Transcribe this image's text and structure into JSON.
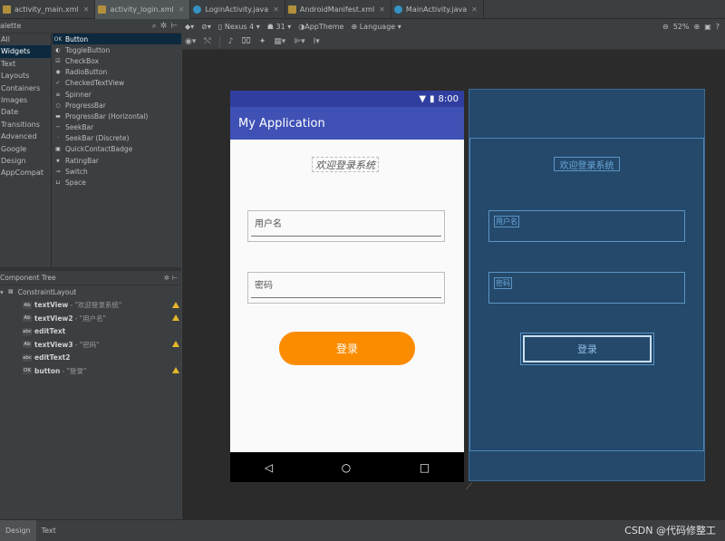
{
  "tabs": [
    {
      "label": "activity_main.xml",
      "icon": "xml"
    },
    {
      "label": "activity_login.xml",
      "icon": "xml",
      "active": true
    },
    {
      "label": "LoginActivity.java",
      "icon": "java"
    },
    {
      "label": "AndroidManifest.xml",
      "icon": "xml"
    },
    {
      "label": "MainActivity.java",
      "icon": "java"
    }
  ],
  "palette": {
    "title": "alette",
    "categories": [
      "All",
      "Widgets",
      "Text",
      "Layouts",
      "Containers",
      "Images",
      "Date",
      "Transitions",
      "Advanced",
      "Google",
      "Design",
      "AppCompat"
    ],
    "selected_category": "Widgets",
    "widgets": [
      {
        "label": "Button",
        "icon": "OK"
      },
      {
        "label": "ToggleButton",
        "icon": "◐"
      },
      {
        "label": "CheckBox",
        "icon": "☑"
      },
      {
        "label": "RadioButton",
        "icon": "◉"
      },
      {
        "label": "CheckedTextView",
        "icon": "✓"
      },
      {
        "label": "Spinner",
        "icon": "≡"
      },
      {
        "label": "ProgressBar",
        "icon": "○"
      },
      {
        "label": "ProgressBar (Horizontal)",
        "icon": "▬"
      },
      {
        "label": "SeekBar",
        "icon": "─"
      },
      {
        "label": "SeekBar (Discrete)",
        "icon": "·"
      },
      {
        "label": "QuickContactBadge",
        "icon": "▣"
      },
      {
        "label": "RatingBar",
        "icon": "★"
      },
      {
        "label": "Switch",
        "icon": "⊸"
      },
      {
        "label": "Space",
        "icon": "⊔"
      }
    ]
  },
  "toolbar": {
    "device": "Nexus 4",
    "api": "31",
    "theme": "AppTheme",
    "language": "Language",
    "zoom": "52%"
  },
  "component_tree": {
    "title": "Component Tree",
    "root": "ConstraintLayout",
    "nodes": [
      {
        "icon": "Ab",
        "name": "textView",
        "sub": "- \"欢迎登录系统\"",
        "warn": true
      },
      {
        "icon": "Ab",
        "name": "textView2",
        "sub": "- \"用户名\"",
        "warn": true
      },
      {
        "icon": "abc",
        "name": "editText",
        "sub": "",
        "warn": false
      },
      {
        "icon": "Ab",
        "name": "textView3",
        "sub": "- \"密码\"",
        "warn": true
      },
      {
        "icon": "abc",
        "name": "editText2",
        "sub": "",
        "warn": false
      },
      {
        "icon": "OK",
        "name": "button",
        "sub": "- \"登录\"",
        "warn": true
      }
    ]
  },
  "preview": {
    "time": "8:00",
    "app_title": "My Application",
    "welcome": "欢迎登录系统",
    "username_label": "用户名",
    "password_label": "密码",
    "login_button": "登录"
  },
  "bottom_tabs": [
    "Design",
    "Text"
  ],
  "watermark": "CSDN @代码修整工",
  "colors": {
    "primary": "#3f51b5",
    "primary_dark": "#303f9f",
    "accent_button": "#fb8c00",
    "blueprint_bg": "#24496b"
  }
}
